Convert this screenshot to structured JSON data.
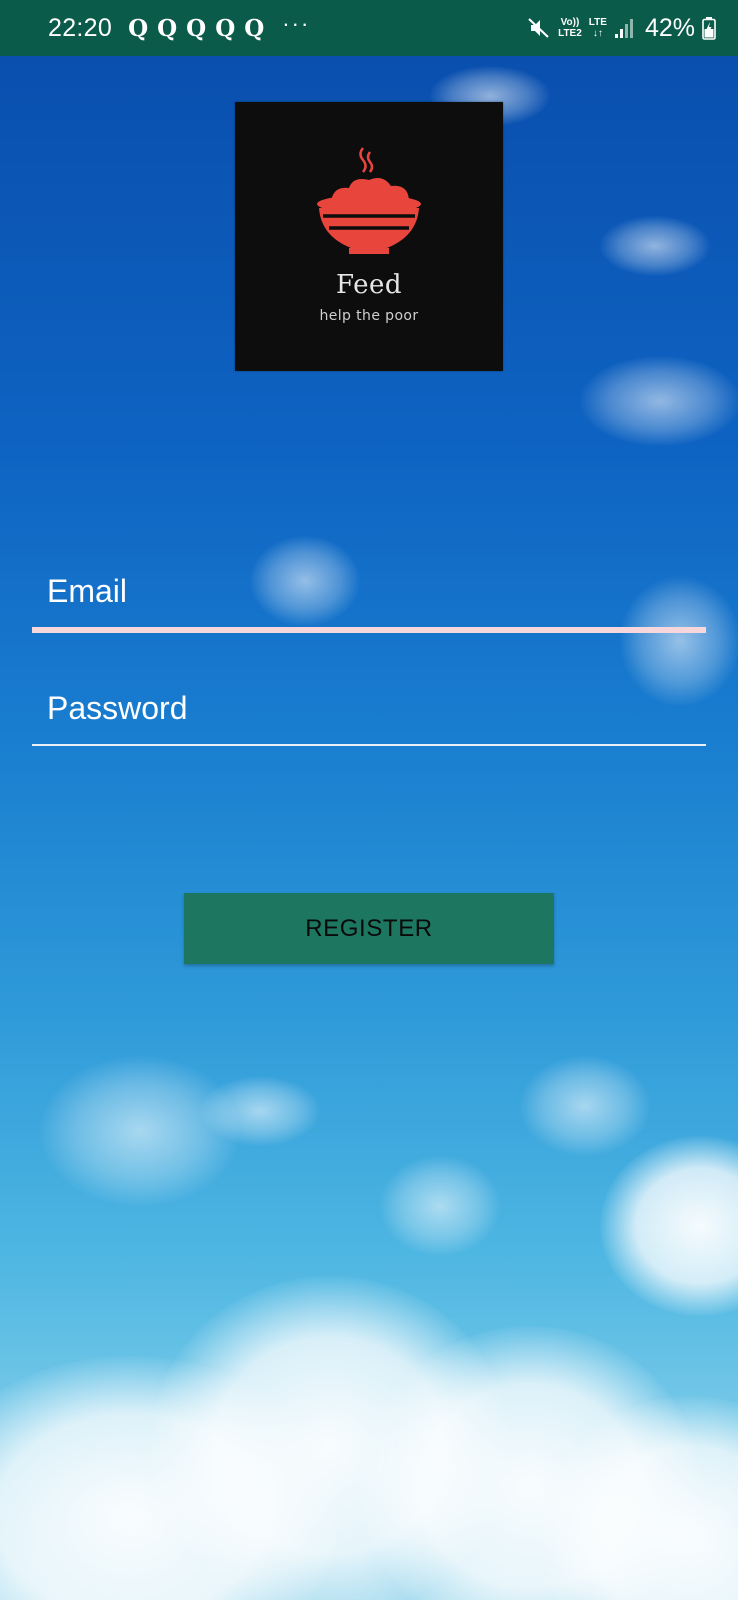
{
  "status_bar": {
    "time": "22:20",
    "app_icons": [
      "Q",
      "Q",
      "Q",
      "Q",
      "Q"
    ],
    "more": "···",
    "network_top": "Vo))",
    "network_bottom": "LTE2",
    "lte_label": "LTE",
    "lte_arrows": "↓↑",
    "battery_percent": "42%",
    "icons": [
      "mute-icon",
      "signal-icon",
      "battery-icon"
    ]
  },
  "logo": {
    "title": "Feed",
    "subtitle": "help the poor",
    "bowl_color": "#e8453c"
  },
  "form": {
    "email_placeholder": "Email",
    "email_value": "",
    "password_placeholder": "Password",
    "password_value": "",
    "register_label": "REGISTER"
  },
  "colors": {
    "status_bar_bg": "#0b5b4a",
    "button_bg": "#1c7660",
    "email_underline_active": "#f7d7dc"
  }
}
